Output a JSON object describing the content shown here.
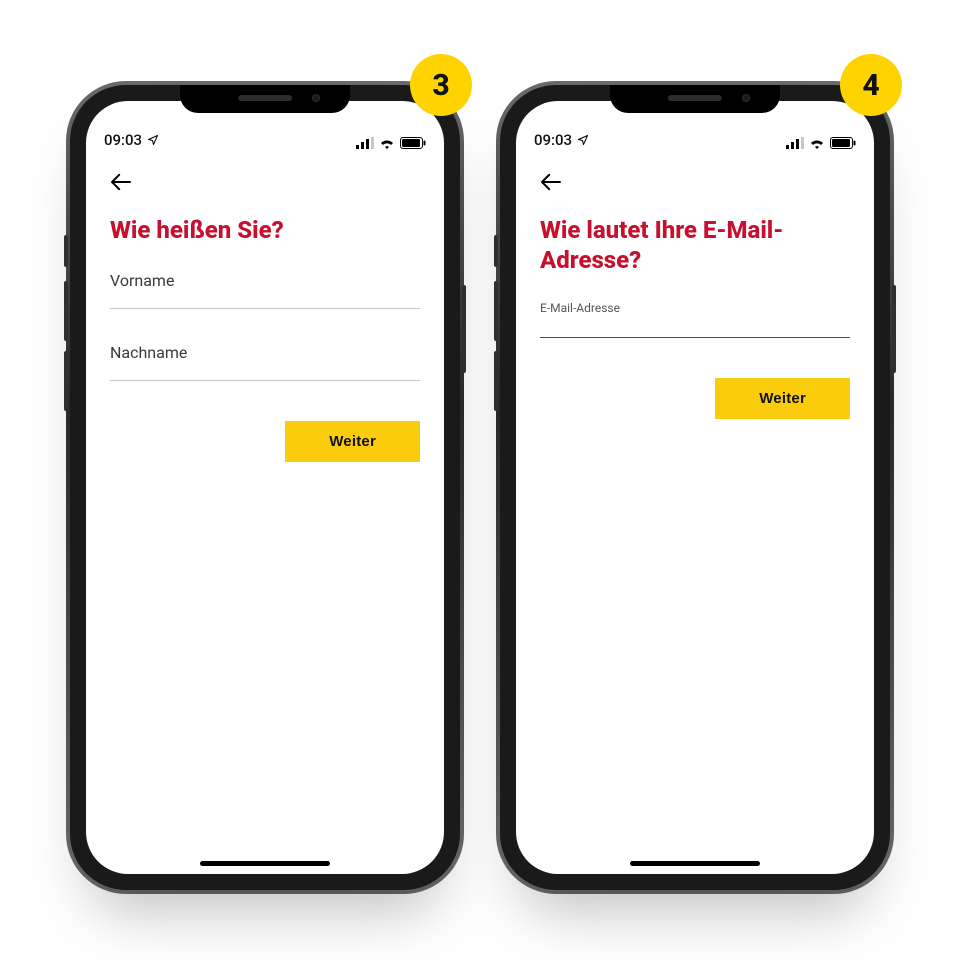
{
  "colors": {
    "accent_yellow": "#ffd300",
    "brand_red": "#c8102e"
  },
  "status": {
    "time": "09:03"
  },
  "screen3": {
    "step_number": "3",
    "title": "Wie heißen Sie?",
    "first_name_label": "Vorname",
    "last_name_label": "Nachname",
    "cta": "Weiter"
  },
  "screen4": {
    "step_number": "4",
    "title": "Wie lautet Ihre E-Mail-Adresse?",
    "email_label": "E-Mail-Adresse",
    "cta": "Weiter"
  }
}
